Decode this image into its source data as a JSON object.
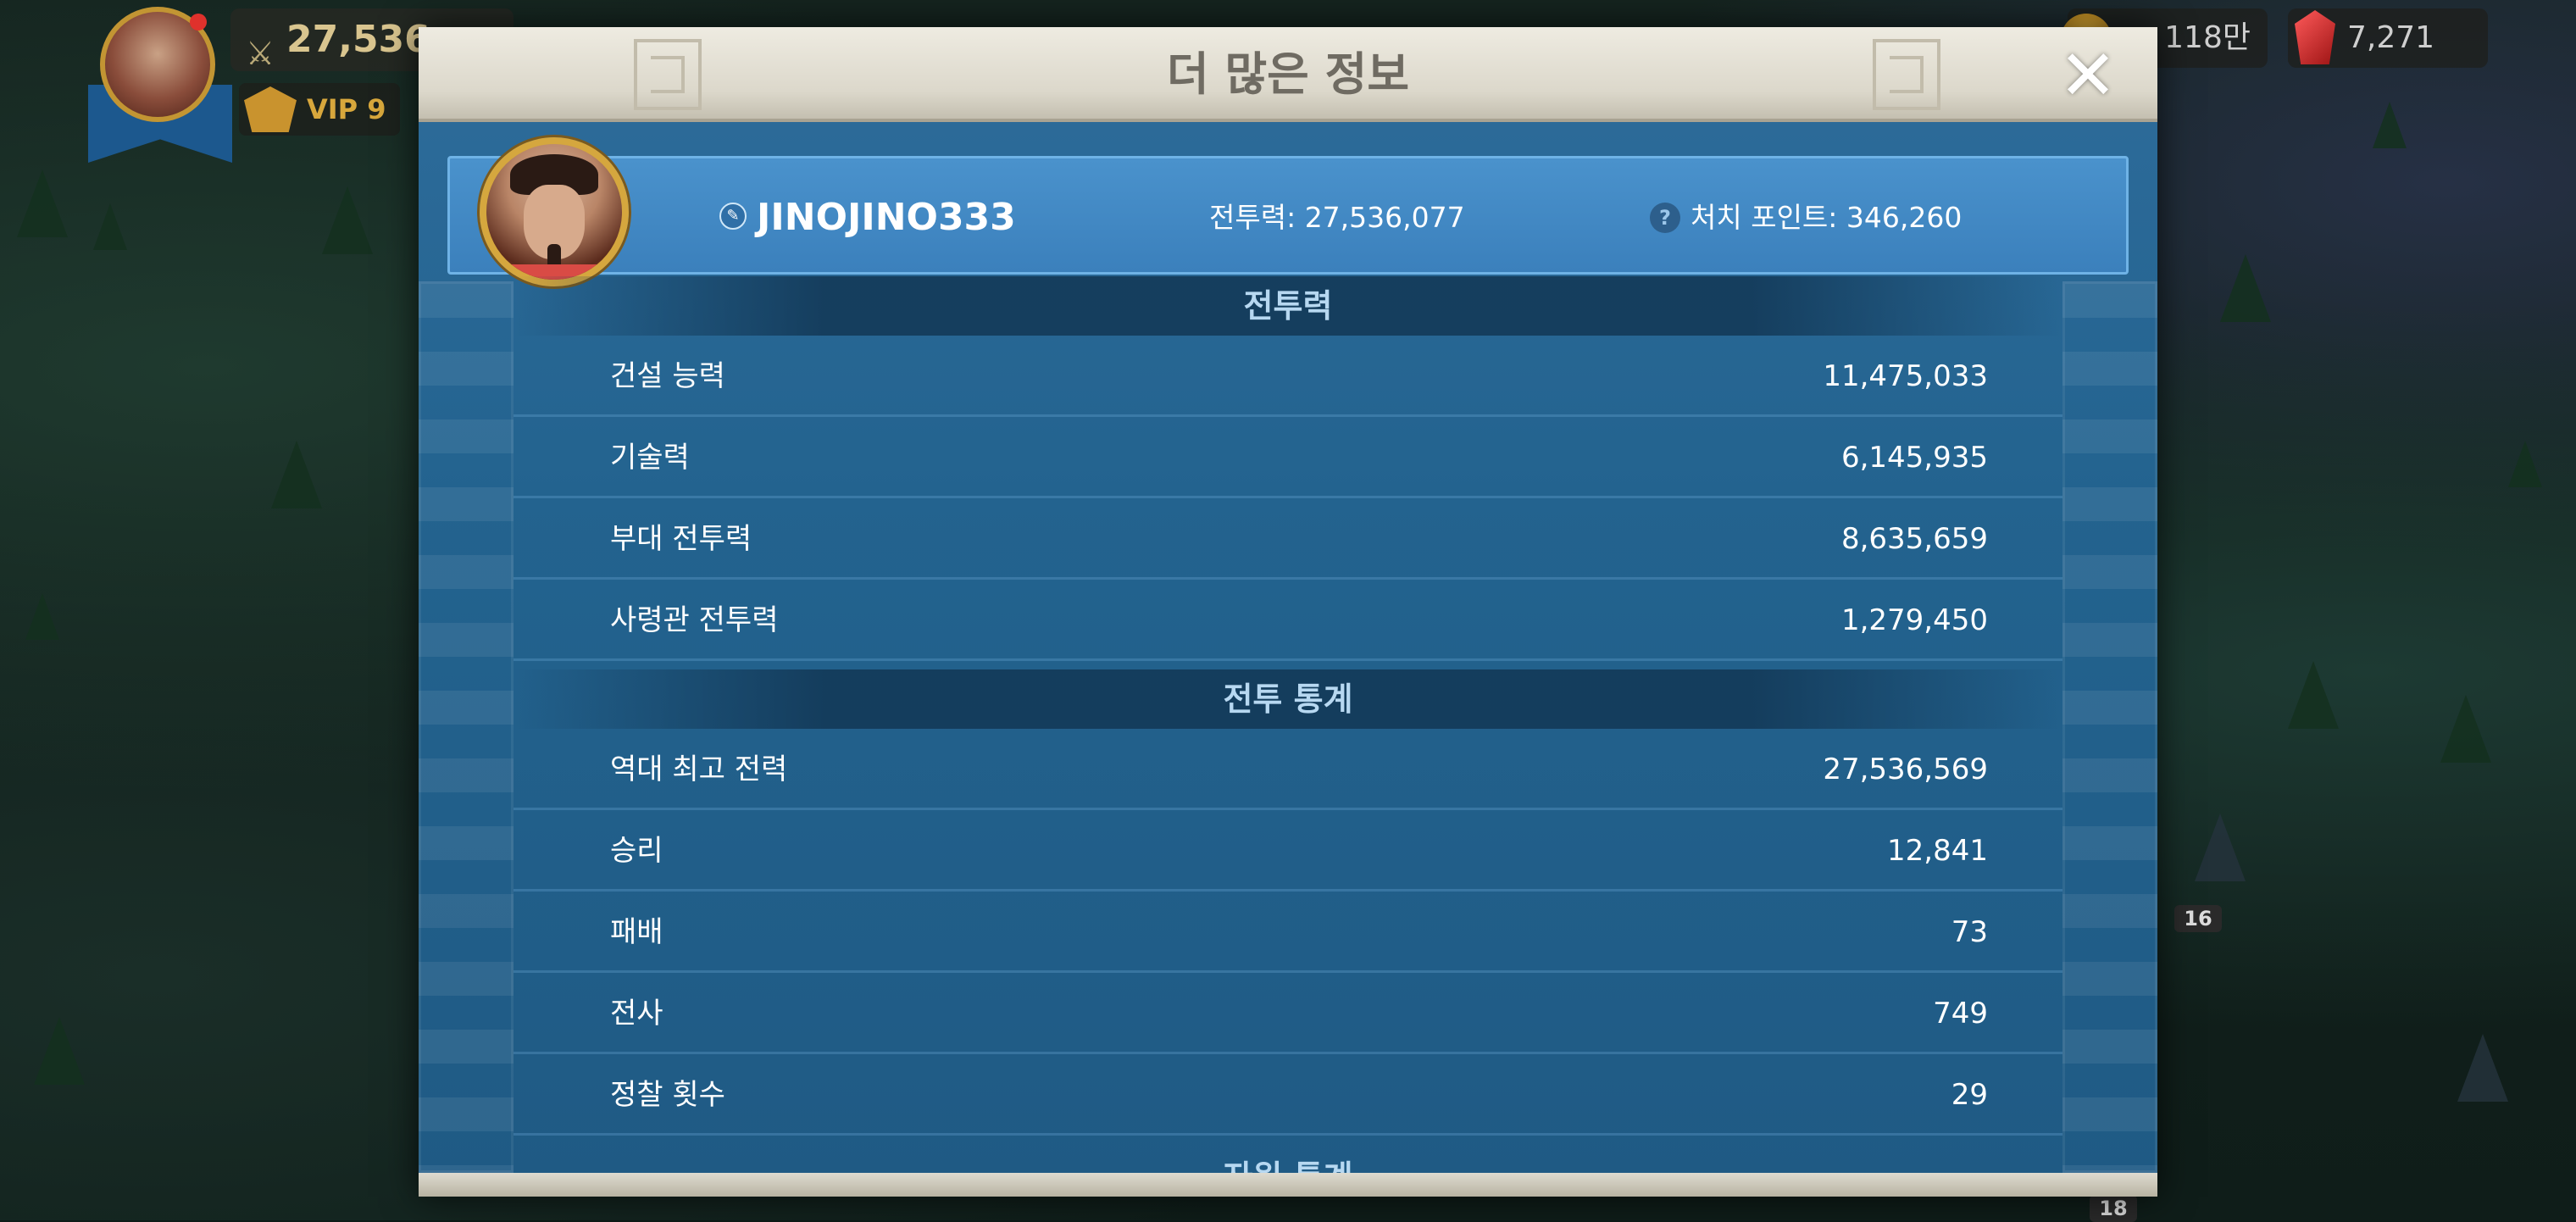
{
  "hud": {
    "power": "27,536",
    "vip": "VIP 9",
    "gold": "118만",
    "gems": "7,271",
    "map_badge_1": "16",
    "map_badge_2": "18"
  },
  "dialog": {
    "title": "더 많은 정보",
    "player": {
      "name": "JINOJINO333",
      "power": "전투력: 27,536,077",
      "kill_points": "처치 포인트: 346,260"
    },
    "power_section": {
      "title": "전투력",
      "rows": [
        {
          "label": "건설 능력",
          "value": "11,475,033"
        },
        {
          "label": "기술력",
          "value": "6,145,935"
        },
        {
          "label": "부대 전투력",
          "value": "8,635,659"
        },
        {
          "label": "사령관 전투력",
          "value": "1,279,450"
        }
      ]
    },
    "battle_section": {
      "title": "전투 통계",
      "rows": [
        {
          "label": "역대 최고 전력",
          "value": "27,536,569"
        },
        {
          "label": "승리",
          "value": "12,841"
        },
        {
          "label": "패배",
          "value": "73"
        },
        {
          "label": "전사",
          "value": "749"
        },
        {
          "label": "정찰 횟수",
          "value": "29"
        }
      ]
    },
    "next_section_partial": "자원 통계"
  },
  "colors": {
    "panel": "#23638f",
    "banner": "#3b80bc",
    "title_bar": "#dcd8cb",
    "header_text": "#b7d8f1"
  }
}
